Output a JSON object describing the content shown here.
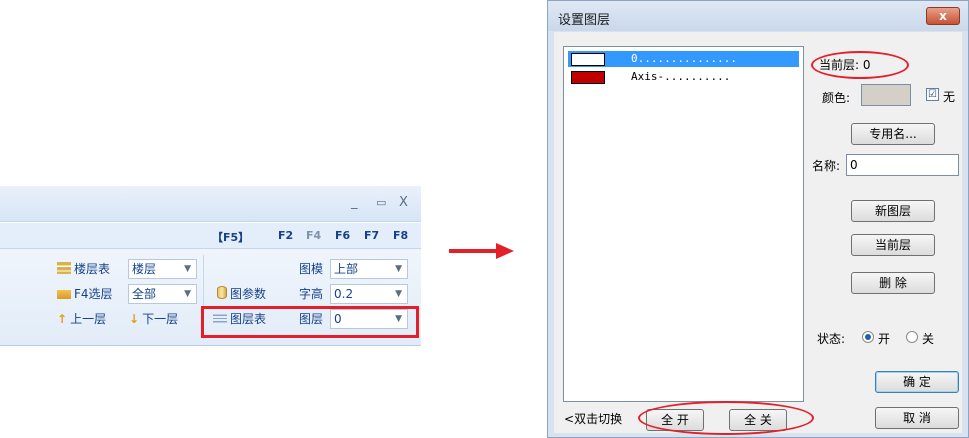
{
  "ribbon": {
    "window_controls": [
      "_",
      "▭",
      "X"
    ],
    "function_keys": [
      "【F5】",
      "F2",
      "F4",
      "F6",
      "F7",
      "F8"
    ],
    "floor_table_label": "楼层表",
    "floor_combo": "楼层",
    "f4_select_label": "F4选层",
    "f4_select_combo": "全部",
    "prev_floor_label": "上一层",
    "next_floor_label": "下一层",
    "graph_params_label": "图参数",
    "layer_table_label": "图层表",
    "template_label": "图模",
    "template_combo": "上部",
    "text_height_label": "字高",
    "text_height_combo": "0.2",
    "layer_label": "图层",
    "layer_combo": "0"
  },
  "dialog": {
    "title": "设置图层",
    "close_label": "x",
    "layers": [
      {
        "name": "0...............",
        "color": "#ffffff",
        "selected": true
      },
      {
        "name": "Axis-..........",
        "color": "#c00000",
        "selected": false
      }
    ],
    "current_layer_text": "当前层: 0",
    "color_label": "颜色:",
    "none_label": "无",
    "none_checked": "☑",
    "special_name_button": "专用名...",
    "name_label": "名称:",
    "name_value": "0",
    "new_layer_button": "新图层",
    "set_current_button": "当前层",
    "delete_button": "删  除",
    "state_label": "状态:",
    "state_on": "开",
    "state_off": "关",
    "ok_button": "确 定",
    "cancel_button": "取 消",
    "double_click_hint": "双击切换",
    "open_all_button": "全 开",
    "close_all_button": "全 关"
  }
}
